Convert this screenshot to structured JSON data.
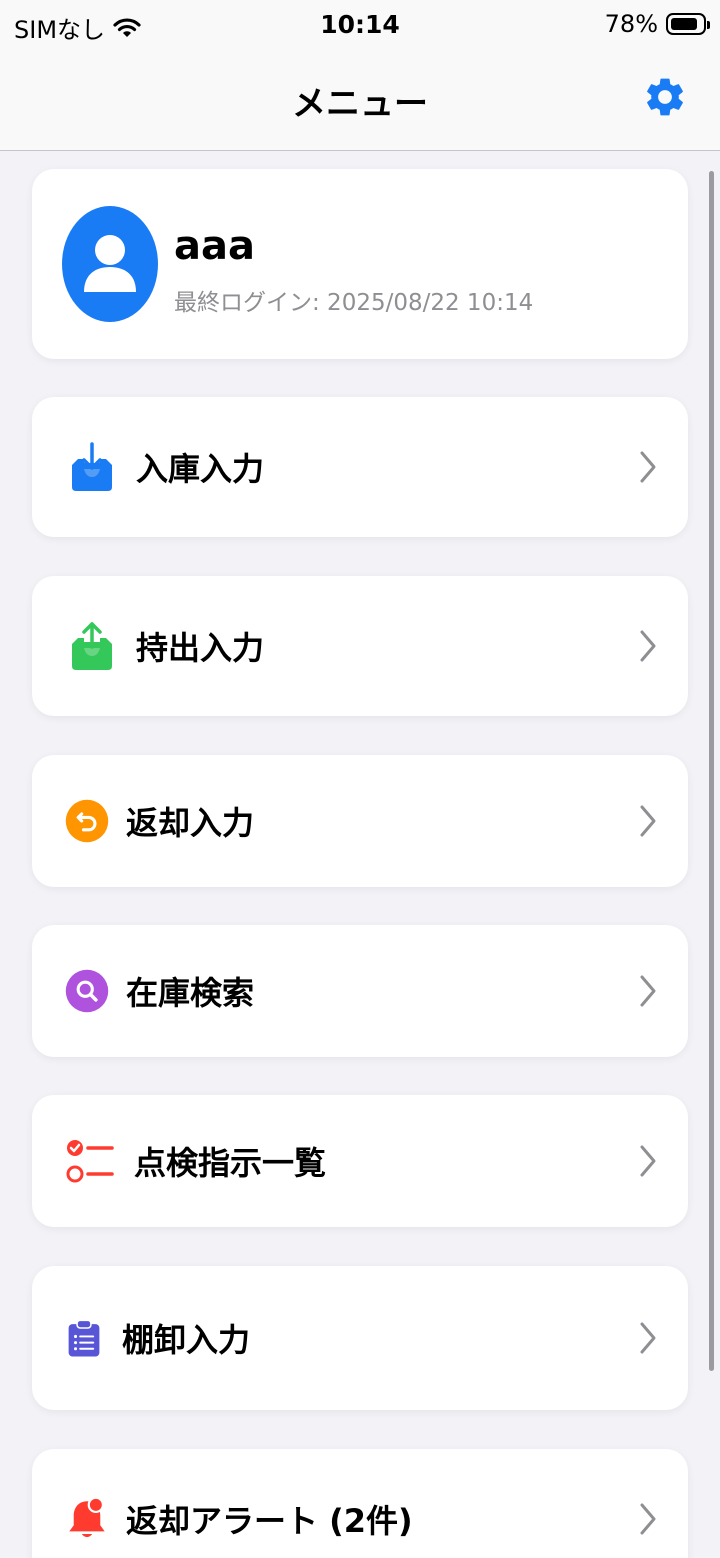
{
  "status_bar": {
    "carrier": "SIMなし",
    "time": "10:14",
    "battery": "78%"
  },
  "nav": {
    "title": "メニュー",
    "settings_icon": "gear-icon"
  },
  "profile": {
    "name": "aaa",
    "last_login": "最終ログイン: 2025/08/22 10:14"
  },
  "menu": [
    {
      "label": "入庫入力",
      "icon": "tray-arrow-down-icon",
      "color": "#1a7cf5"
    },
    {
      "label": "持出入力",
      "icon": "tray-arrow-up-icon",
      "color": "#34c759"
    },
    {
      "label": "返却入力",
      "icon": "return-arrow-icon",
      "color": "#ff9500"
    },
    {
      "label": "在庫検索",
      "icon": "search-icon",
      "color": "#af52de"
    },
    {
      "label": "点検指示一覧",
      "icon": "checklist-icon",
      "color": "#ff3b30"
    },
    {
      "label": "棚卸入力",
      "icon": "clipboard-list-icon",
      "color": "#5856d6"
    },
    {
      "label": "返却アラート (2件)",
      "icon": "bell-badge-icon",
      "color": "#ff3b30"
    }
  ],
  "colors": {
    "accent": "#1a7cf5",
    "background": "#f2f2f7"
  }
}
